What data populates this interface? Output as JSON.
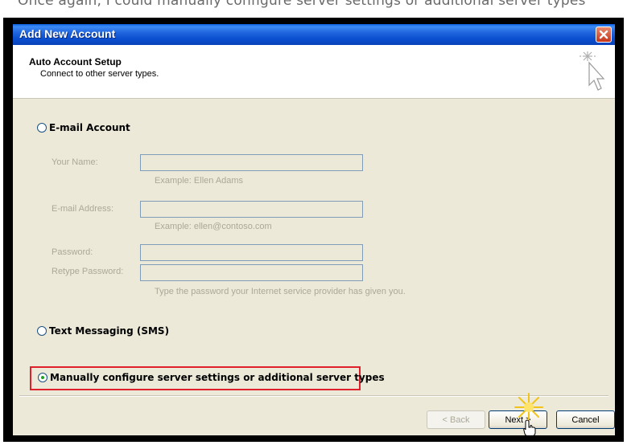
{
  "window": {
    "title": "Add New Account",
    "close_label": "Close"
  },
  "top_strip": {
    "text": "Once again, I could manually configure server settings or additional server types"
  },
  "header": {
    "title": "Auto Account Setup",
    "subtitle": "Connect to other server types."
  },
  "options": {
    "email_account": {
      "label": "E-mail Account",
      "selected": false
    },
    "text_messaging": {
      "label": "Text Messaging (SMS)",
      "selected": false
    },
    "manual_config": {
      "label": "Manually configure server settings or additional server types",
      "selected": true
    }
  },
  "fields": {
    "your_name": {
      "label": "Your Name:",
      "value": "",
      "hint": "Example: Ellen Adams"
    },
    "email_address": {
      "label": "E-mail Address:",
      "value": "",
      "hint": "Example: ellen@contoso.com"
    },
    "password": {
      "label": "Password:",
      "value": ""
    },
    "retype_password": {
      "label": "Retype Password:",
      "value": "",
      "hint": "Type the password your Internet service provider has given you."
    }
  },
  "buttons": {
    "back": "< Back",
    "next": "Next >",
    "cancel": "Cancel"
  },
  "colors": {
    "titlebar": "#0b4fd0",
    "highlight": "#e0202a",
    "dialog_bg": "#ece9d8"
  }
}
